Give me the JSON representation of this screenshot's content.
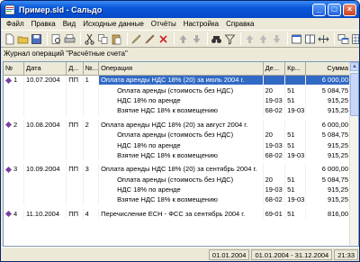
{
  "window": {
    "title": "Пpимep.sld - Сальдо",
    "minimize": "_",
    "maximize": "□",
    "close": "×"
  },
  "menu": [
    "Файл",
    "Правка",
    "Вид",
    "Исходные данные",
    "Отчёты",
    "Настройка",
    "Справка"
  ],
  "journal_title": "Журнал операций \"Расчётные счета\"",
  "columns": [
    "№",
    "Дата",
    "Д...",
    "№...",
    "Операция",
    "Де...",
    "Кр...",
    "Сумма"
  ],
  "rows": [
    {
      "kind": "op",
      "num": "1",
      "date": "10.07.2004",
      "doc": "ПП",
      "docnum": "1",
      "desc": "Оплата аренды НДС 18% (20) за июль 2004 г.",
      "debit": "",
      "credit": "",
      "sum": "6 000,00",
      "selected": true
    },
    {
      "kind": "sub",
      "desc": "Оплата аренды (стоимость без НДС)",
      "debit": "20",
      "credit": "51",
      "sum": "5 084,75"
    },
    {
      "kind": "sub",
      "desc": "НДС 18% по аренде",
      "debit": "19-03",
      "credit": "51",
      "sum": "915,25"
    },
    {
      "kind": "sub",
      "desc": "Взятие НДС 18% к возмещению",
      "debit": "68-02",
      "credit": "19-03",
      "sum": "915,25"
    },
    {
      "kind": "op",
      "num": "2",
      "date": "10.08.2004",
      "doc": "ПП",
      "docnum": "2",
      "desc": "Оплата аренды НДС 18% (20) за август 2004 г.",
      "debit": "",
      "credit": "",
      "sum": "6 000,00",
      "selected": false
    },
    {
      "kind": "sub",
      "desc": "Оплата аренды (стоимость без НДС)",
      "debit": "20",
      "credit": "51",
      "sum": "5 084,75"
    },
    {
      "kind": "sub",
      "desc": "НДС 18% по аренде",
      "debit": "19-03",
      "credit": "51",
      "sum": "915,25"
    },
    {
      "kind": "sub",
      "desc": "Взятие НДС 18% к возмещению",
      "debit": "68-02",
      "credit": "19-03",
      "sum": "915,25"
    },
    {
      "kind": "op",
      "num": "3",
      "date": "10.09.2004",
      "doc": "ПП",
      "docnum": "3",
      "desc": "Оплата аренды НДС 18% (20) за сентябрь 2004 г.",
      "debit": "",
      "credit": "",
      "sum": "6 000,00",
      "selected": false
    },
    {
      "kind": "sub",
      "desc": "Оплата аренды (стоимость без НДС)",
      "debit": "20",
      "credit": "51",
      "sum": "5 084,75"
    },
    {
      "kind": "sub",
      "desc": "НДС 18% по аренде",
      "debit": "19-03",
      "credit": "51",
      "sum": "915,25"
    },
    {
      "kind": "sub",
      "desc": "Взятие НДС 18% к возмещению",
      "debit": "68-02",
      "credit": "19-03",
      "sum": "915,25"
    },
    {
      "kind": "op",
      "num": "4",
      "date": "11.10.2004",
      "doc": "ПП",
      "docnum": "4",
      "desc": "Перечисление ЕСН - ФСС за сентябрь 2004 г.",
      "debit": "69-01",
      "credit": "51",
      "sum": "816,00",
      "selected": false
    }
  ],
  "status": {
    "date": "01.01.2004",
    "period": "01.01.2004 - 31.12.2004",
    "time": "21:33"
  },
  "toolbar_icons": [
    "new-file-icon",
    "open-folder-icon",
    "save-icon",
    "print-preview-icon",
    "print-icon",
    "cut-icon",
    "copy-icon",
    "paste-icon",
    "pencil-icon",
    "edit-icon",
    "delete-icon",
    "arrow-up-icon",
    "arrow-down-icon",
    "binoculars-icon",
    "filter-icon",
    "arrow-up-dim-icon",
    "arrow-up-dim-icon",
    "arrow-down-dim-icon",
    "window-icon",
    "column-icon",
    "split-icon",
    "windows-icon",
    "grid-icon"
  ],
  "colors": {
    "selection": "#316ac5",
    "titlebar": "#0a58d8",
    "diamond": "#7a3fa0"
  }
}
